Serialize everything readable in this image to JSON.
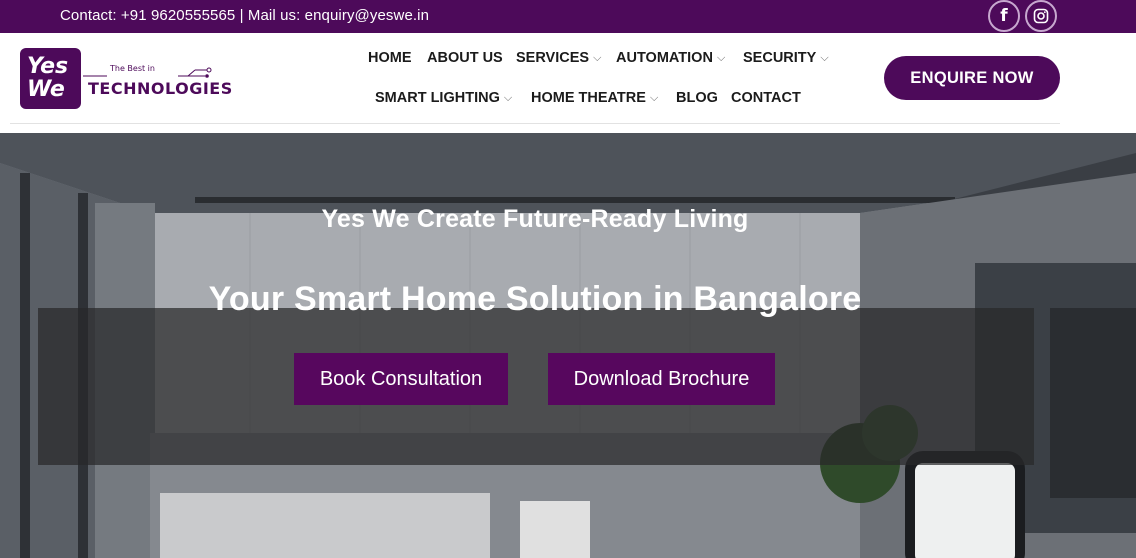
{
  "topbar": {
    "contact_text": "Contact: +91 9620555565 | Mail us: enquiry@yeswe.in",
    "social": [
      {
        "icon": "facebook-icon",
        "glyph": "f"
      },
      {
        "icon": "instagram-icon"
      }
    ]
  },
  "logo": {
    "mark_line1": "Yes",
    "mark_line2": "We",
    "tagline": "The Best in",
    "word": "TECHNOLOGIES"
  },
  "nav": {
    "row1": [
      {
        "label": "HOME",
        "dropdown": false
      },
      {
        "label": "ABOUT US",
        "dropdown": false
      },
      {
        "label": "SERVICES",
        "dropdown": true
      },
      {
        "label": "AUTOMATION",
        "dropdown": true
      },
      {
        "label": "SECURITY",
        "dropdown": true
      }
    ],
    "row2": [
      {
        "label": "SMART LIGHTING",
        "dropdown": true
      },
      {
        "label": "HOME THEATRE",
        "dropdown": true
      },
      {
        "label": "BLOG",
        "dropdown": false
      },
      {
        "label": "CONTACT",
        "dropdown": false
      }
    ],
    "chevron": "⌵"
  },
  "header": {
    "enquire_label": "ENQUIRE NOW"
  },
  "hero": {
    "subtitle": "Yes We Create Future-Ready Living",
    "title": "Your Smart Home Solution in Bangalore",
    "book_label": "Book Consultation",
    "brochure_label": "Download Brochure"
  },
  "colors": {
    "brand": "#4d0a5a",
    "button": "#57075e",
    "overlay": "#28282a"
  }
}
